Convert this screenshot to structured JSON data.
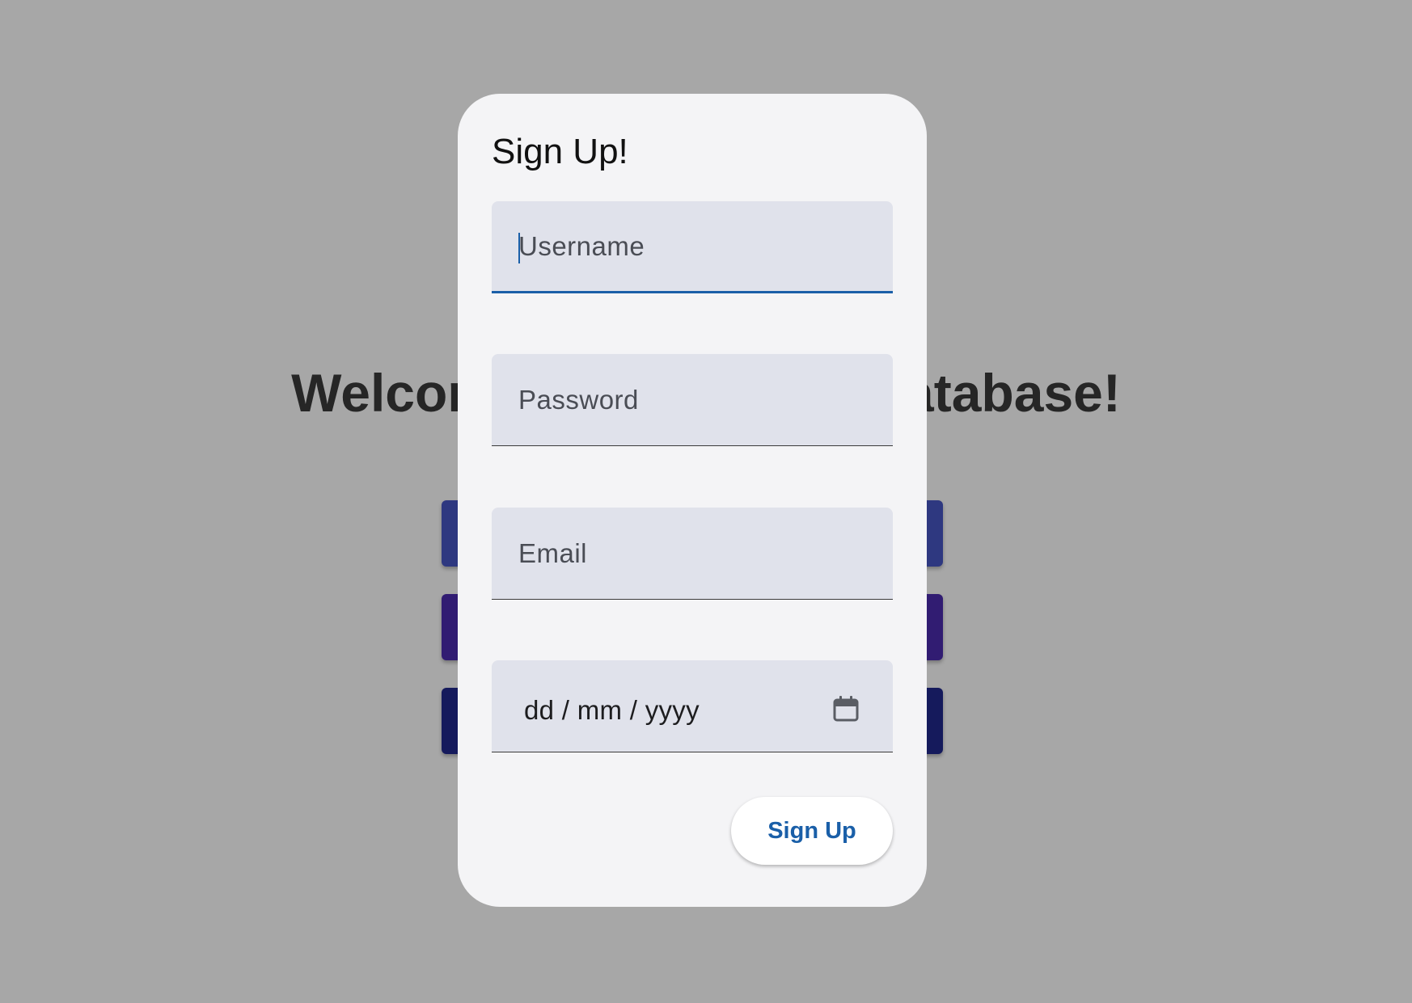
{
  "background": {
    "heading": "Welcome to the Movie Database!",
    "buttons": [
      {
        "color": "#2e3880"
      },
      {
        "color": "#311c72"
      },
      {
        "color": "#151a5c"
      }
    ],
    "overlay_color": "#a7a7a7"
  },
  "dialog": {
    "title": "Sign Up!",
    "fields": {
      "username": {
        "placeholder": "Username",
        "value": "",
        "focused": true
      },
      "password": {
        "placeholder": "Password",
        "value": ""
      },
      "email": {
        "placeholder": "Email",
        "value": ""
      },
      "date": {
        "display": "dd / mm / yyyy",
        "icon": "calendar-icon"
      }
    },
    "submit_label": "Sign Up"
  },
  "colors": {
    "accent": "#1a5fa8",
    "field_background": "#e0e2eb",
    "dialog_background": "#f4f4f6"
  }
}
